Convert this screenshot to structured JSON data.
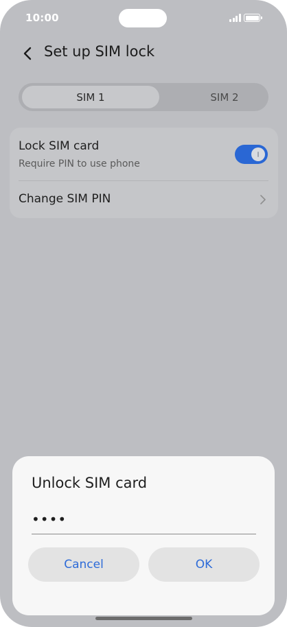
{
  "status_bar": {
    "time": "10:00"
  },
  "header": {
    "title": "Set up SIM lock",
    "back_icon": "chevron-left-icon"
  },
  "tabs": [
    {
      "label": "SIM 1",
      "selected": true
    },
    {
      "label": "SIM 2",
      "selected": false
    }
  ],
  "settings": {
    "lock_sim": {
      "title": "Lock SIM card",
      "subtitle": "Require PIN to use phone",
      "enabled": true
    },
    "change_pin": {
      "title": "Change SIM PIN",
      "icon": "chevron-right-icon"
    }
  },
  "dialog": {
    "title": "Unlock SIM card",
    "pin_value": "••••",
    "cancel_label": "Cancel",
    "ok_label": "OK"
  },
  "colors": {
    "accent": "#2d6bd8",
    "toggle_on": "#2a67d4",
    "scrim": "#bdbec2"
  }
}
